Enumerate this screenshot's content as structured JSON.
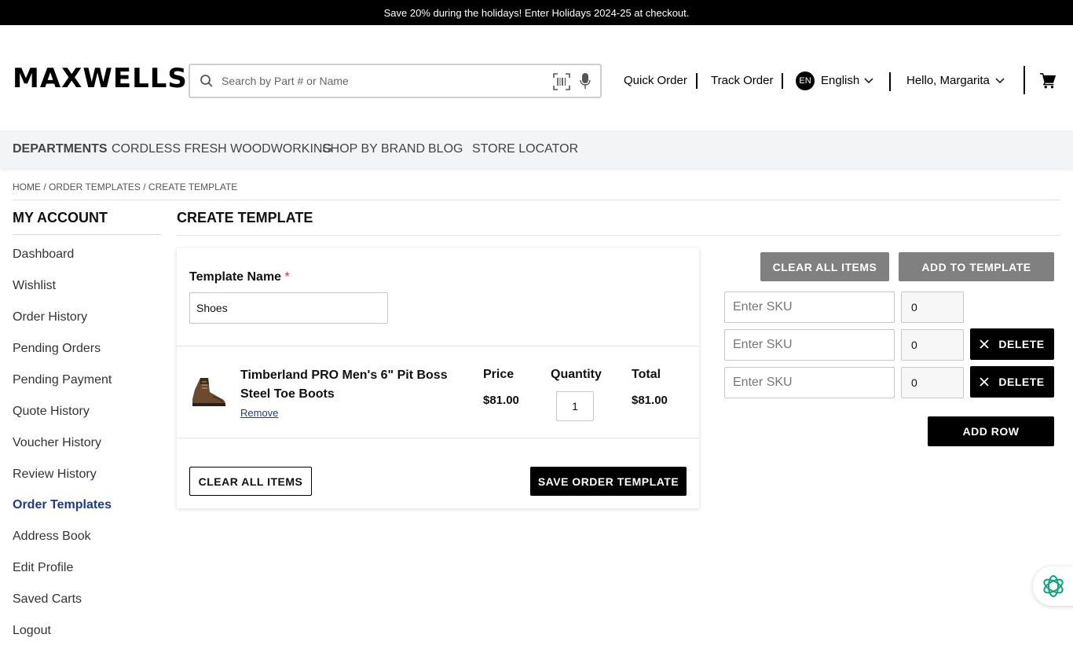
{
  "promo": {
    "text": "Save 20% during the holidays! Enter Holidays 2024-25 at checkout."
  },
  "header": {
    "logo": "MAXWELLS",
    "search_placeholder": "Search by Part # or Name",
    "quick_order": "Quick Order",
    "track_order": "Track Order",
    "lang_code": "EN",
    "lang_label": "English",
    "greeting": "Hello, Margarita"
  },
  "mainnav": {
    "items": [
      "DEPARTMENTS",
      "CORDLESS FRESH WOODWORKING",
      "SHOP BY BRAND",
      "BLOG",
      "STORE LOCATOR"
    ]
  },
  "breadcrumb": "HOME / ORDER TEMPLATES / CREATE TEMPLATE",
  "sidebar": {
    "title": "MY ACCOUNT",
    "items": [
      {
        "label": "Dashboard"
      },
      {
        "label": "Wishlist"
      },
      {
        "label": "Order History"
      },
      {
        "label": "Pending Orders"
      },
      {
        "label": "Pending Payment"
      },
      {
        "label": "Quote History"
      },
      {
        "label": "Voucher History"
      },
      {
        "label": "Review History"
      },
      {
        "label": "Order Templates",
        "active": true
      },
      {
        "label": "Address Book"
      },
      {
        "label": "Edit Profile"
      },
      {
        "label": "Saved Carts"
      },
      {
        "label": "Logout"
      }
    ]
  },
  "page": {
    "title": "CREATE TEMPLATE",
    "template_name_label": "Template Name",
    "required_mark": "*",
    "template_name_value": "Shoes",
    "product": {
      "name": "Timberland PRO Men's 6\" Pit Boss Steel Toe Boots",
      "remove_label": "Remove",
      "price_header": "Price",
      "price": "$81.00",
      "quantity_header": "Quantity",
      "quantity": "1",
      "total_header": "Total",
      "total": "$81.00"
    },
    "clear_all_label": "CLEAR ALL ITEMS",
    "save_label": "SAVE ORDER TEMPLATE"
  },
  "sku_panel": {
    "clear_all_label": "CLEAR ALL ITEMS",
    "add_to_template_label": "ADD TO TEMPLATE",
    "sku_placeholder": "Enter SKU",
    "rows": [
      {
        "qty": "0"
      },
      {
        "qty": "0",
        "delete_label": "DELETE"
      },
      {
        "qty": "0",
        "delete_label": "DELETE"
      }
    ],
    "add_row_label": "ADD ROW"
  },
  "colors": {
    "brand": "#000000",
    "link": "#1f3a8a",
    "required": "#d32f2f",
    "assistant": "#10a37f"
  }
}
